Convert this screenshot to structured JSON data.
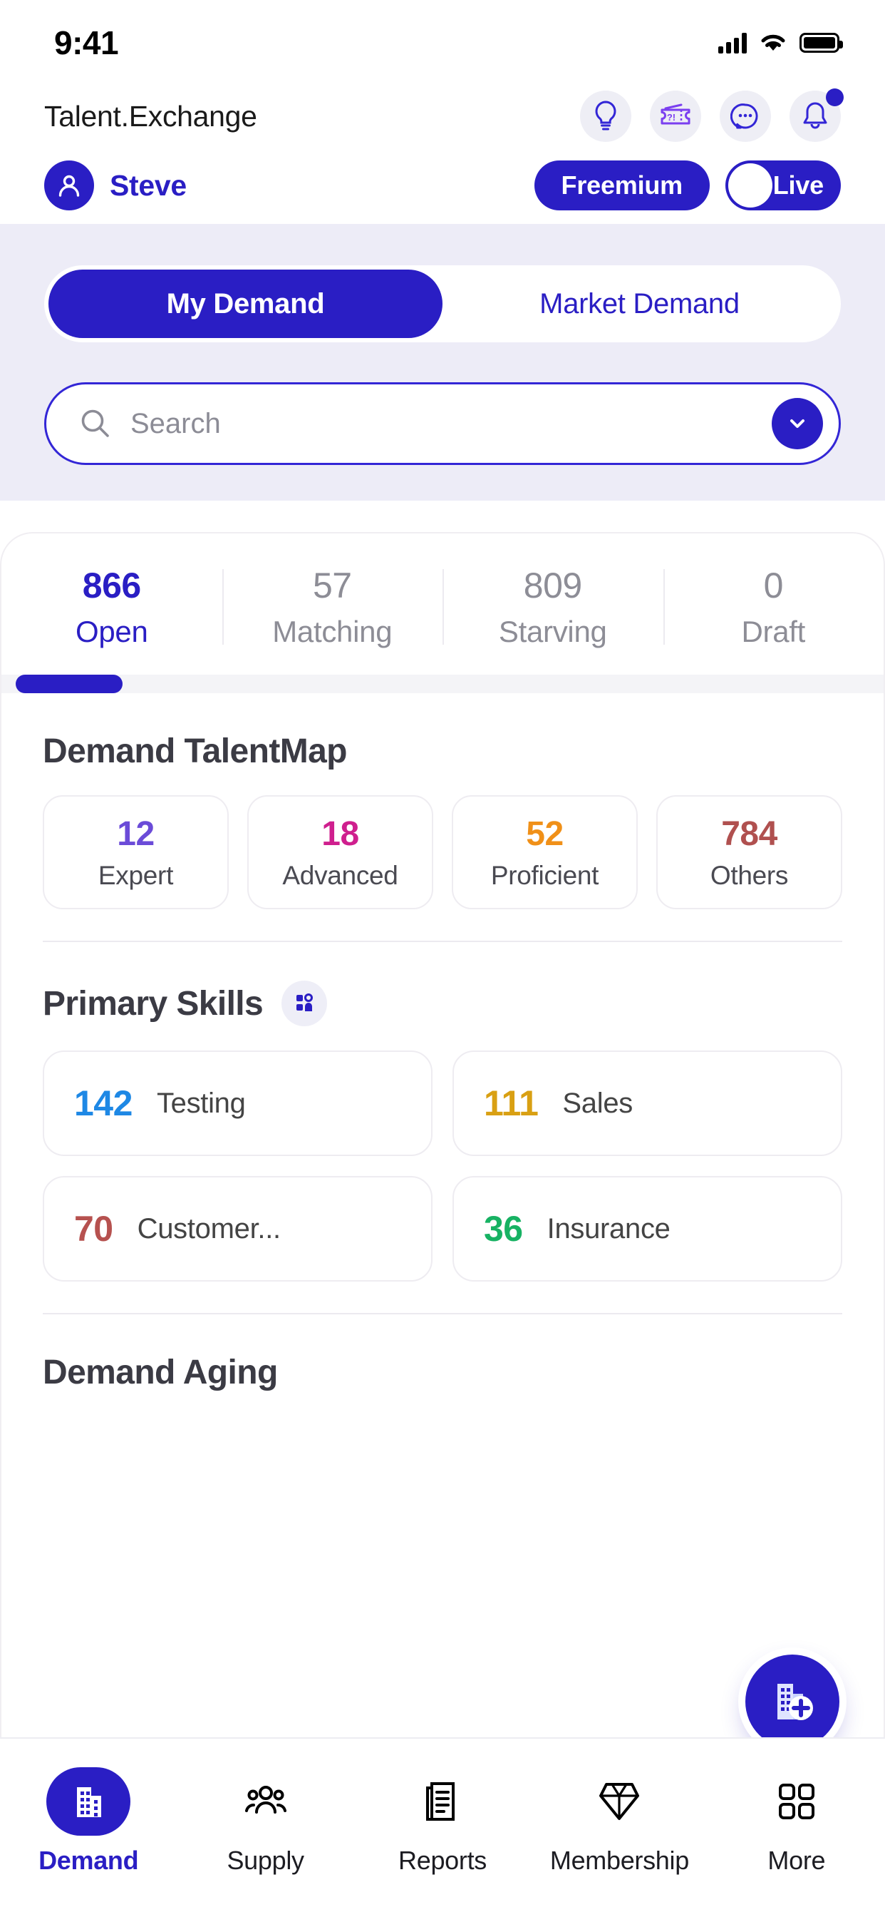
{
  "status_bar": {
    "time": "9:41"
  },
  "header": {
    "brand": "Talent.Exchange",
    "icons": [
      {
        "name": "lightbulb-icon",
        "label": "Ideas"
      },
      {
        "name": "ticket-icon",
        "label": "Support Ticket"
      },
      {
        "name": "chat-icon",
        "label": "Chat"
      },
      {
        "name": "bell-icon",
        "label": "Notifications"
      }
    ],
    "user_name": "Steve",
    "plan_label": "Freemium",
    "live_label": "Live",
    "live_on": false
  },
  "tabs": [
    {
      "label": "My Demand",
      "active": true
    },
    {
      "label": "Market Demand",
      "active": false
    }
  ],
  "search": {
    "value": "",
    "placeholder": "Search"
  },
  "stats": [
    {
      "value": "866",
      "label": "Open",
      "active": true
    },
    {
      "value": "57",
      "label": "Matching",
      "active": false
    },
    {
      "value": "809",
      "label": "Starving",
      "active": false
    },
    {
      "value": "0",
      "label": "Draft",
      "active": false
    }
  ],
  "talentmap": {
    "title": "Demand TalentMap",
    "levels": [
      {
        "value": "12",
        "label": "Expert",
        "color": "#6b4bd8"
      },
      {
        "value": "18",
        "label": "Advanced",
        "color": "#cf1f8e"
      },
      {
        "value": "52",
        "label": "Proficient",
        "color": "#f09018"
      },
      {
        "value": "784",
        "label": "Others",
        "color": "#b0504f"
      }
    ]
  },
  "primary_skills": {
    "title": "Primary Skills",
    "items": [
      {
        "value": "142",
        "label": "Testing",
        "color": "#1e88e5"
      },
      {
        "value": "111",
        "label": "Sales",
        "color": "#d9a013"
      },
      {
        "value": "70",
        "label": "Customer...",
        "color": "#b6514f"
      },
      {
        "value": "36",
        "label": "Insurance",
        "color": "#17b263"
      }
    ]
  },
  "demand_aging": {
    "title": "Demand Aging"
  },
  "fab": {
    "name": "add-demand-button"
  },
  "bottom_nav": [
    {
      "label": "Demand",
      "icon": "building-icon",
      "active": true
    },
    {
      "label": "Supply",
      "icon": "people-icon",
      "active": false
    },
    {
      "label": "Reports",
      "icon": "document-icon",
      "active": false
    },
    {
      "label": "Membership",
      "icon": "diamond-icon",
      "active": false
    },
    {
      "label": "More",
      "icon": "grid-icon",
      "active": false
    }
  ],
  "colors": {
    "brand": "#2a1ec4",
    "panel": "#edecf7"
  }
}
